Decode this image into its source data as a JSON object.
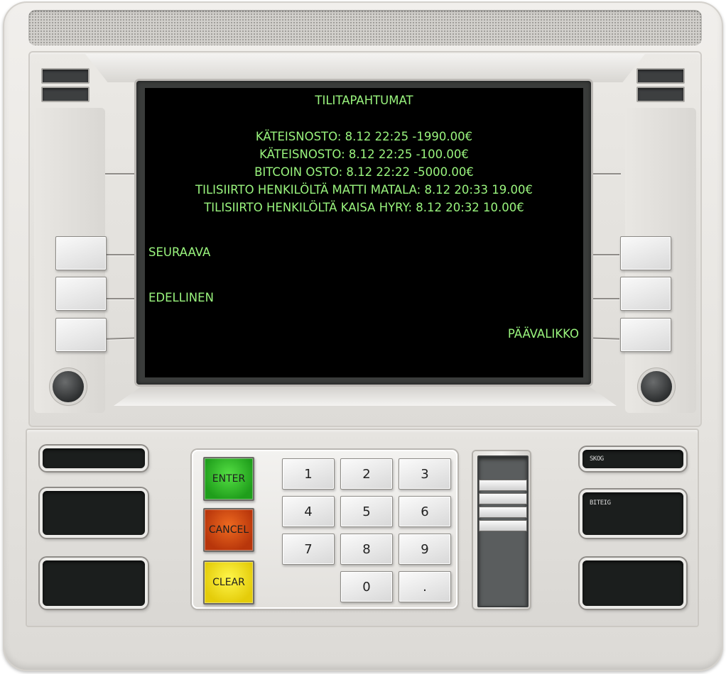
{
  "screen": {
    "title": "TILITAPAHTUMAT",
    "transactions": [
      "KÄTEISNOSTO: 8.12 22:25 -1990.00€",
      "KÄTEISNOSTO: 8.12 22:25 -100.00€",
      "BITCOIN OSTO: 8.12 22:22 -5000.00€",
      "TILISIIRTO HENKILÖLTÄ MATTI MATALA: 8.12 20:33 19.00€",
      "TILISIIRTO HENKILÖLTÄ KAISA HYRY: 8.12 20:32 10.00€"
    ],
    "left_options": [
      "SEURAAVA",
      "EDELLINEN"
    ],
    "right_options": [
      "PÄÄVALIKKO"
    ]
  },
  "keypad": {
    "enter_label": "ENTER",
    "cancel_label": "CANCEL",
    "clear_label": "CLEAR",
    "numbers": [
      "1",
      "2",
      "3",
      "4",
      "5",
      "6",
      "7",
      "8",
      "9",
      "0",
      "."
    ]
  },
  "right_slots": {
    "receipt_label": "SKOG",
    "card_label": "BITEIG"
  },
  "colors": {
    "screen_text": "#9af57e",
    "screen_background": "#000000",
    "enter_key": "#2fbf2a",
    "cancel_key": "#d24a12",
    "clear_key": "#f2e21a"
  }
}
